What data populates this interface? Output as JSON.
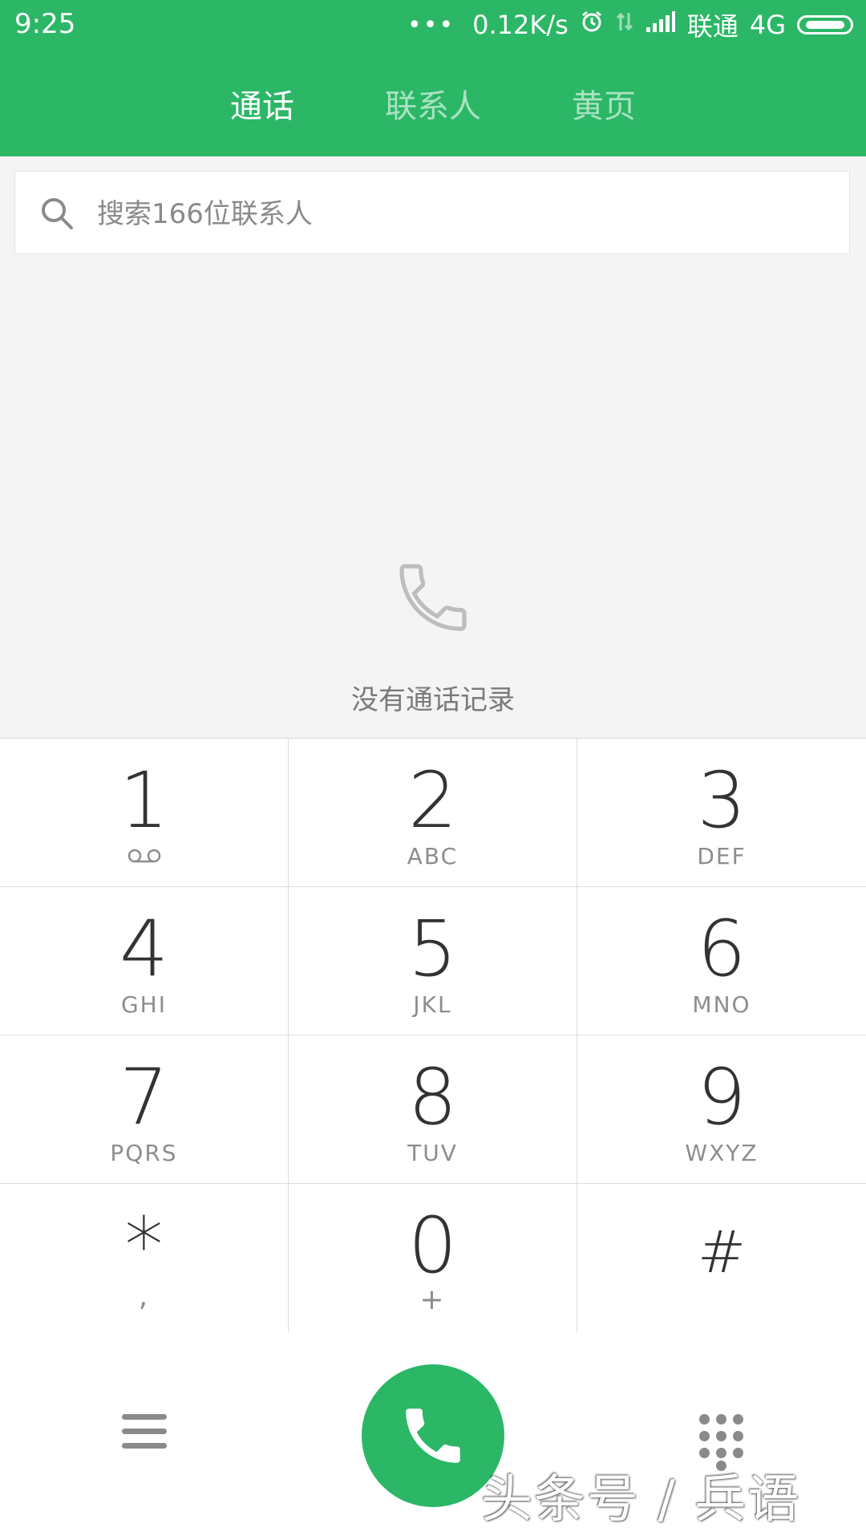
{
  "status_bar": {
    "time": "9:25",
    "network_speed": "0.12K/s",
    "carrier": "联通",
    "network_type": "4G",
    "icons": [
      "more-dots-icon",
      "alarm-icon",
      "data-arrows-icon",
      "signal-icon",
      "battery-icon"
    ]
  },
  "tabs": [
    {
      "label": "通话",
      "active": true
    },
    {
      "label": "联系人",
      "active": false
    },
    {
      "label": "黄页",
      "active": false
    }
  ],
  "search": {
    "placeholder": "搜索166位联系人",
    "icon": "search-icon"
  },
  "empty_state": {
    "icon": "phone-icon",
    "text": "没有通话记录"
  },
  "keypad": [
    {
      "digit": "1",
      "letters": "",
      "sub_icon": "voicemail-icon"
    },
    {
      "digit": "2",
      "letters": "ABC"
    },
    {
      "digit": "3",
      "letters": "DEF"
    },
    {
      "digit": "4",
      "letters": "GHI"
    },
    {
      "digit": "5",
      "letters": "JKL"
    },
    {
      "digit": "6",
      "letters": "MNO"
    },
    {
      "digit": "7",
      "letters": "PQRS"
    },
    {
      "digit": "8",
      "letters": "TUV"
    },
    {
      "digit": "9",
      "letters": "WXYZ"
    },
    {
      "digit": "*",
      "letters": ","
    },
    {
      "digit": "0",
      "letters": "+"
    },
    {
      "digit": "#",
      "letters": ""
    }
  ],
  "bottom_bar": {
    "left_icon": "menu-icon",
    "center_icon": "call-icon",
    "right_icon": "dialpad-icon"
  },
  "watermark": "头条号 / 兵语",
  "colors": {
    "brand_green": "#2bb766",
    "background": "#f4f4f4",
    "key_text": "#333333",
    "muted_text": "#8d8d8d"
  }
}
